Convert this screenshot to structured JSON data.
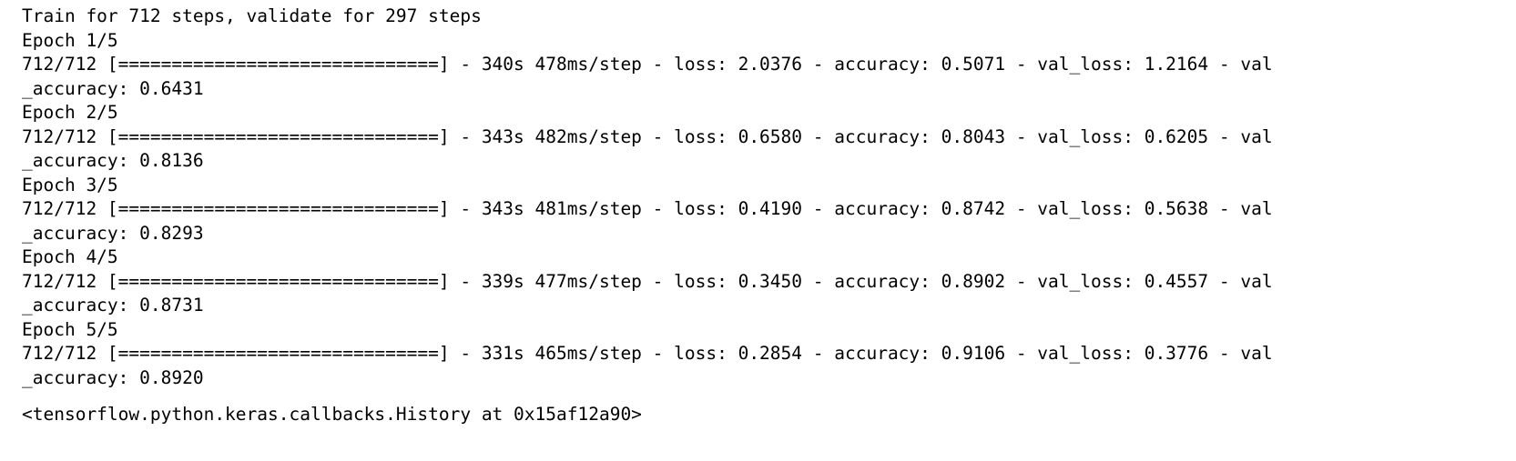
{
  "output": {
    "summary_line": "Train for 712 steps, validate for 297 steps",
    "epochs": [
      {
        "header": "Epoch 1/5",
        "progress": "712/712 [==============================] - 340s 478ms/step - loss: 2.0376 - accuracy: 0.5071 - val_loss: 1.2164 - val",
        "continuation": "_accuracy: 0.6431"
      },
      {
        "header": "Epoch 2/5",
        "progress": "712/712 [==============================] - 343s 482ms/step - loss: 0.6580 - accuracy: 0.8043 - val_loss: 0.6205 - val",
        "continuation": "_accuracy: 0.8136"
      },
      {
        "header": "Epoch 3/5",
        "progress": "712/712 [==============================] - 343s 481ms/step - loss: 0.4190 - accuracy: 0.8742 - val_loss: 0.5638 - val",
        "continuation": "_accuracy: 0.8293"
      },
      {
        "header": "Epoch 4/5",
        "progress": "712/712 [==============================] - 339s 477ms/step - loss: 0.3450 - accuracy: 0.8902 - val_loss: 0.4557 - val",
        "continuation": "_accuracy: 0.8731"
      },
      {
        "header": "Epoch 5/5",
        "progress": "712/712 [==============================] - 331s 465ms/step - loss: 0.2854 - accuracy: 0.9106 - val_loss: 0.3776 - val",
        "continuation": "_accuracy: 0.8920"
      }
    ],
    "return_value": "<tensorflow.python.keras.callbacks.History at 0x15af12a90>"
  }
}
